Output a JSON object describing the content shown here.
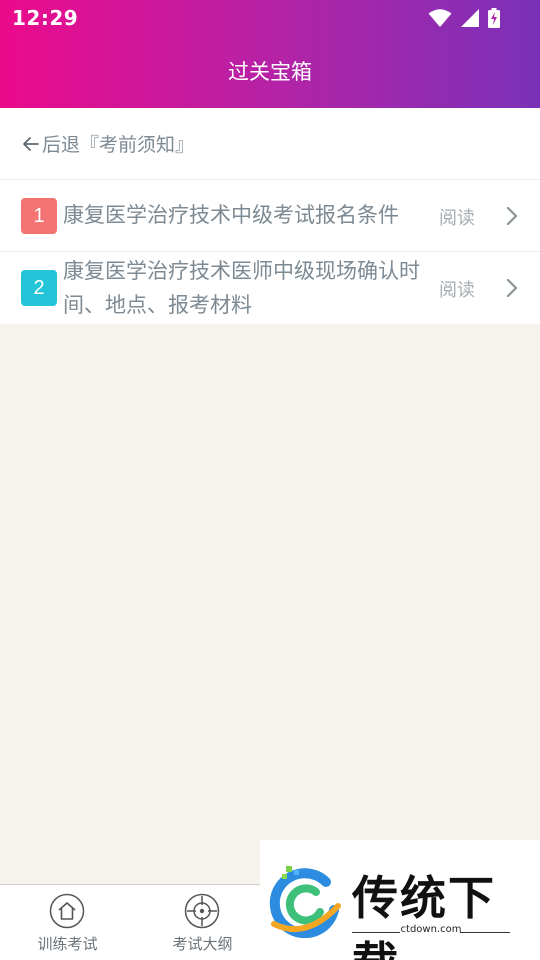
{
  "status_bar": {
    "time": "12:29",
    "icons": [
      "wifi-icon",
      "signal-icon",
      "battery-charging-icon"
    ]
  },
  "header": {
    "title": "过关宝箱",
    "gradient": [
      "#ec0a8c",
      "#7a31b8"
    ]
  },
  "back_bar": {
    "icon": "arrow-left-icon",
    "label": "后退『考前须知』"
  },
  "items": [
    {
      "number": "1",
      "title": "康复医学治疗技术中级考试报名条件",
      "action": "阅读",
      "badge_color": "#f47373"
    },
    {
      "number": "2",
      "title": "康复医学治疗技术医师中级现场确认时间、地点、报考材料",
      "action": "阅读",
      "badge_color": "#22c4d8"
    }
  ],
  "bottom_nav": [
    {
      "label": "训练考试",
      "icon": "home-icon"
    },
    {
      "label": "考试大纲",
      "icon": "target-icon"
    }
  ],
  "watermark": {
    "brand": "传统下载",
    "url": "ctdown.com"
  }
}
